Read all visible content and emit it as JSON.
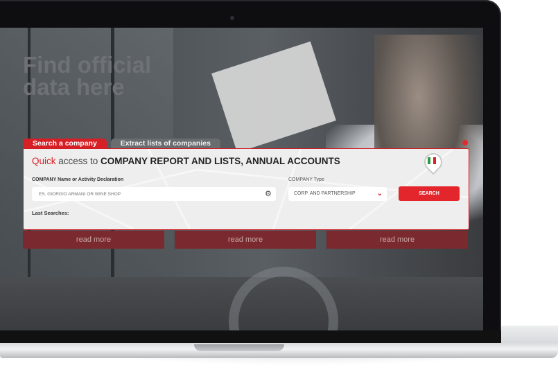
{
  "hero": {
    "headline": "Find official data here"
  },
  "tabs": [
    {
      "label": "Search a company",
      "active": true
    },
    {
      "label": "Extract lists of companies",
      "active": false
    }
  ],
  "panel": {
    "title_quick": "Quick",
    "title_access": " access to ",
    "title_main": "COMPANY REPORT AND LISTS, ANNUAL ACCOUNTS",
    "name_label": "COMPANY Name or Activity Declaration",
    "name_placeholder": "ES. GIORGIO ARMANI OR WINE SHOP",
    "type_label": "COMPANY Type",
    "type_value": "CORP. AND PARTNERSHIP",
    "search_label": "SEARCH",
    "last_searches": "Last Searches:"
  },
  "read_more": [
    "read more",
    "read more",
    "read more"
  ],
  "colors": {
    "accent": "#d71f26",
    "read_more_bg": "#7a2a2e"
  },
  "icons": {
    "settings": "gear-icon",
    "dropdown": "chevron-down-icon",
    "location": "map-pin-icon",
    "close": "close-icon"
  }
}
